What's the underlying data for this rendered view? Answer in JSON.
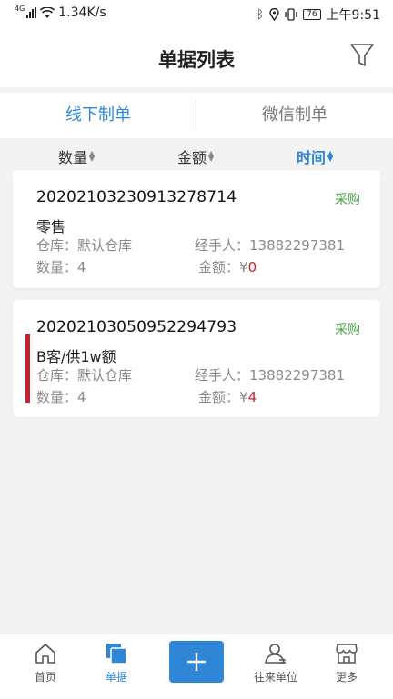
{
  "status": {
    "network": "4G",
    "speed": "1.34K/s",
    "battery": "76",
    "time": "上午9:51"
  },
  "header": {
    "title": "单据列表",
    "filter_icon": "filter-icon"
  },
  "tabs": [
    {
      "label": "线下制单",
      "active": true
    },
    {
      "label": "微信制单",
      "active": false
    }
  ],
  "sort": [
    {
      "label": "数量"
    },
    {
      "label": "金额"
    },
    {
      "label": "时间",
      "active": true
    }
  ],
  "cards": [
    {
      "order_no": "202021032309132787​14",
      "tag": "采购",
      "customer": "零售",
      "warehouse_label": "仓库：",
      "warehouse": "默认仓库",
      "handler_label": "经手人：",
      "handler": "13882297381",
      "qty_label": "数量：",
      "qty": "4",
      "amount_label": "金额：",
      "currency": "¥",
      "amount": "0"
    },
    {
      "order_no": "20202103050952294793",
      "tag": "采购",
      "customer": "B客/供1w额",
      "warehouse_label": "仓库：",
      "warehouse": "默认仓库",
      "handler_label": "经手人：",
      "handler": "13882297381",
      "qty_label": "数量：",
      "qty": "4",
      "amount_label": "金额：",
      "currency": "¥",
      "amount": "4"
    }
  ],
  "nav": [
    {
      "label": "首页",
      "icon": "home-icon"
    },
    {
      "label": "单据",
      "icon": "documents-icon",
      "active": true
    },
    {
      "label": "",
      "icon": "plus-icon"
    },
    {
      "label": "往来单位",
      "icon": "contacts-icon"
    },
    {
      "label": "更多",
      "icon": "store-icon"
    }
  ],
  "colors": {
    "accent": "#2f86d6",
    "tag_green": "#4ca548",
    "amount_red": "#c8232c"
  }
}
